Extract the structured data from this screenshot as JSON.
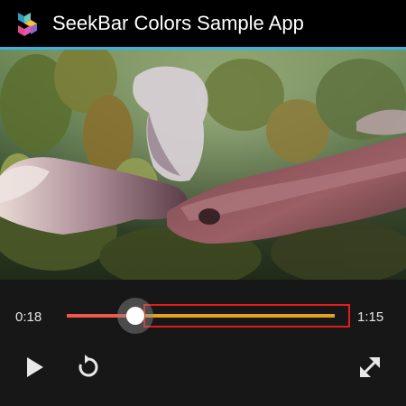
{
  "action_bar": {
    "title": "SeekBar Colors Sample App",
    "icon": "app-logo-icon",
    "background_color": "#000000",
    "divider_color": "#33b5e5"
  },
  "video": {
    "content": "video-frame"
  },
  "player": {
    "current_time": "0:18",
    "total_time": "1:15",
    "progress_fraction": 0.24,
    "progress_color": "#f1574d",
    "remaining_color": "#e6a120",
    "highlight_color": "#e21b1b",
    "controls": {
      "play_icon": "play-icon",
      "replay_icon": "replay-icon",
      "fullscreen_icon": "fullscreen-icon"
    }
  }
}
